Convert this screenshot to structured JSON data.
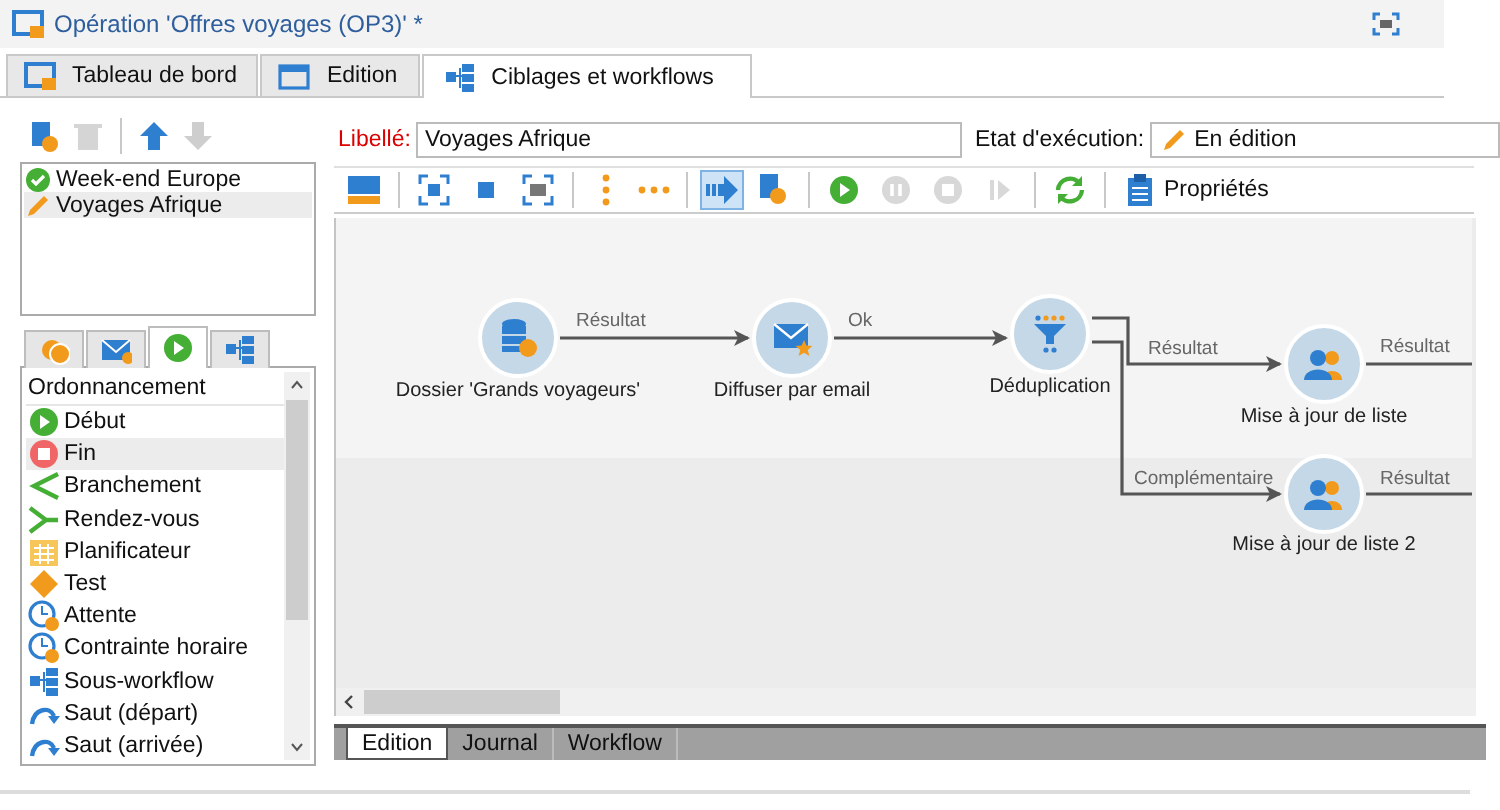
{
  "window": {
    "title": "Opération 'Offres voyages  (OP3)' *"
  },
  "tabs": [
    {
      "label": "Tableau de bord",
      "kind": "dashboard",
      "selected": false
    },
    {
      "label": "Edition",
      "kind": "edition",
      "selected": false
    },
    {
      "label": "Ciblages et workflows",
      "kind": "workflow",
      "selected": true
    }
  ],
  "list_toolbar": [
    {
      "kind": "new",
      "disabled": false
    },
    {
      "kind": "delete",
      "disabled": true
    },
    {
      "kind": "separator"
    },
    {
      "kind": "up",
      "disabled": false
    },
    {
      "kind": "down",
      "disabled": true
    }
  ],
  "workflows": [
    {
      "label": "Week-end Europe",
      "kind": "done",
      "selected": false
    },
    {
      "label": "Voyages Afrique",
      "kind": "editing",
      "selected": true
    }
  ],
  "palette": {
    "tabs": [
      {
        "kind": "targeting",
        "selected": false
      },
      {
        "kind": "delivery",
        "selected": false
      },
      {
        "kind": "flow",
        "selected": true
      },
      {
        "kind": "tools",
        "selected": false
      }
    ],
    "heading": "Ordonnancement",
    "items": [
      {
        "label": "Début",
        "kind": "start",
        "selected": false
      },
      {
        "label": "Fin",
        "kind": "end",
        "selected": true
      },
      {
        "label": "Branchement",
        "kind": "fork",
        "selected": false
      },
      {
        "label": "Rendez-vous",
        "kind": "join",
        "selected": false
      },
      {
        "label": "Planificateur",
        "kind": "scheduler",
        "selected": false
      },
      {
        "label": "Test",
        "kind": "test",
        "selected": false
      },
      {
        "label": "Attente",
        "kind": "clock",
        "selected": false
      },
      {
        "label": "Contrainte horaire",
        "kind": "clock",
        "selected": false
      },
      {
        "label": "Sous-workflow",
        "kind": "subflow",
        "selected": false
      },
      {
        "label": "Saut (départ)",
        "kind": "jump",
        "selected": false
      },
      {
        "label": "Saut (arrivée)",
        "kind": "jump",
        "selected": false
      }
    ]
  },
  "form": {
    "label_caption": "Libellé:",
    "label_value": "Voyages Afrique",
    "state_caption": "Etat d'exécution:",
    "state_value": "En édition"
  },
  "toolbar": [
    {
      "kind": "layout",
      "selected": false,
      "disabled": false
    },
    {
      "kind": "separator"
    },
    {
      "kind": "fit",
      "selected": false,
      "disabled": false
    },
    {
      "kind": "small",
      "selected": false,
      "disabled": false
    },
    {
      "kind": "zoom",
      "selected": false,
      "disabled": false
    },
    {
      "kind": "separator"
    },
    {
      "kind": "vdots",
      "selected": false,
      "disabled": false
    },
    {
      "kind": "hdots",
      "selected": false,
      "disabled": false
    },
    {
      "kind": "separator"
    },
    {
      "kind": "connect",
      "selected": true,
      "disabled": false
    },
    {
      "kind": "newflow",
      "selected": false,
      "disabled": false
    },
    {
      "kind": "separator"
    },
    {
      "kind": "play",
      "selected": false,
      "disabled": false
    },
    {
      "kind": "pause",
      "selected": false,
      "disabled": true
    },
    {
      "kind": "stop",
      "selected": false,
      "disabled": true
    },
    {
      "kind": "step",
      "selected": false,
      "disabled": true
    },
    {
      "kind": "separator"
    },
    {
      "kind": "refresh",
      "selected": false,
      "disabled": false
    },
    {
      "kind": "separator"
    },
    {
      "kind": "properties",
      "label": "Propriétés",
      "selected": false,
      "disabled": false
    }
  ],
  "diagram": {
    "nodes": [
      {
        "kind": "query",
        "label": "Dossier 'Grands voyageurs'"
      },
      {
        "kind": "email",
        "label": "Diffuser par email"
      },
      {
        "kind": "dedup",
        "label": "Déduplication"
      },
      {
        "kind": "list",
        "label": "Mise à jour de liste"
      },
      {
        "kind": "list",
        "label": "Mise à jour de liste 2"
      }
    ],
    "edges": [
      {
        "label": "Résultat"
      },
      {
        "label": "Ok"
      },
      {
        "label": "Résultat"
      },
      {
        "label": "Complémentaire"
      },
      {
        "label": "Résultat"
      },
      {
        "label": "Résultat"
      }
    ]
  },
  "bottom_tabs": [
    {
      "label": "Edition",
      "selected": true
    },
    {
      "label": "Journal",
      "selected": false
    },
    {
      "label": "Workflow",
      "selected": false
    }
  ]
}
